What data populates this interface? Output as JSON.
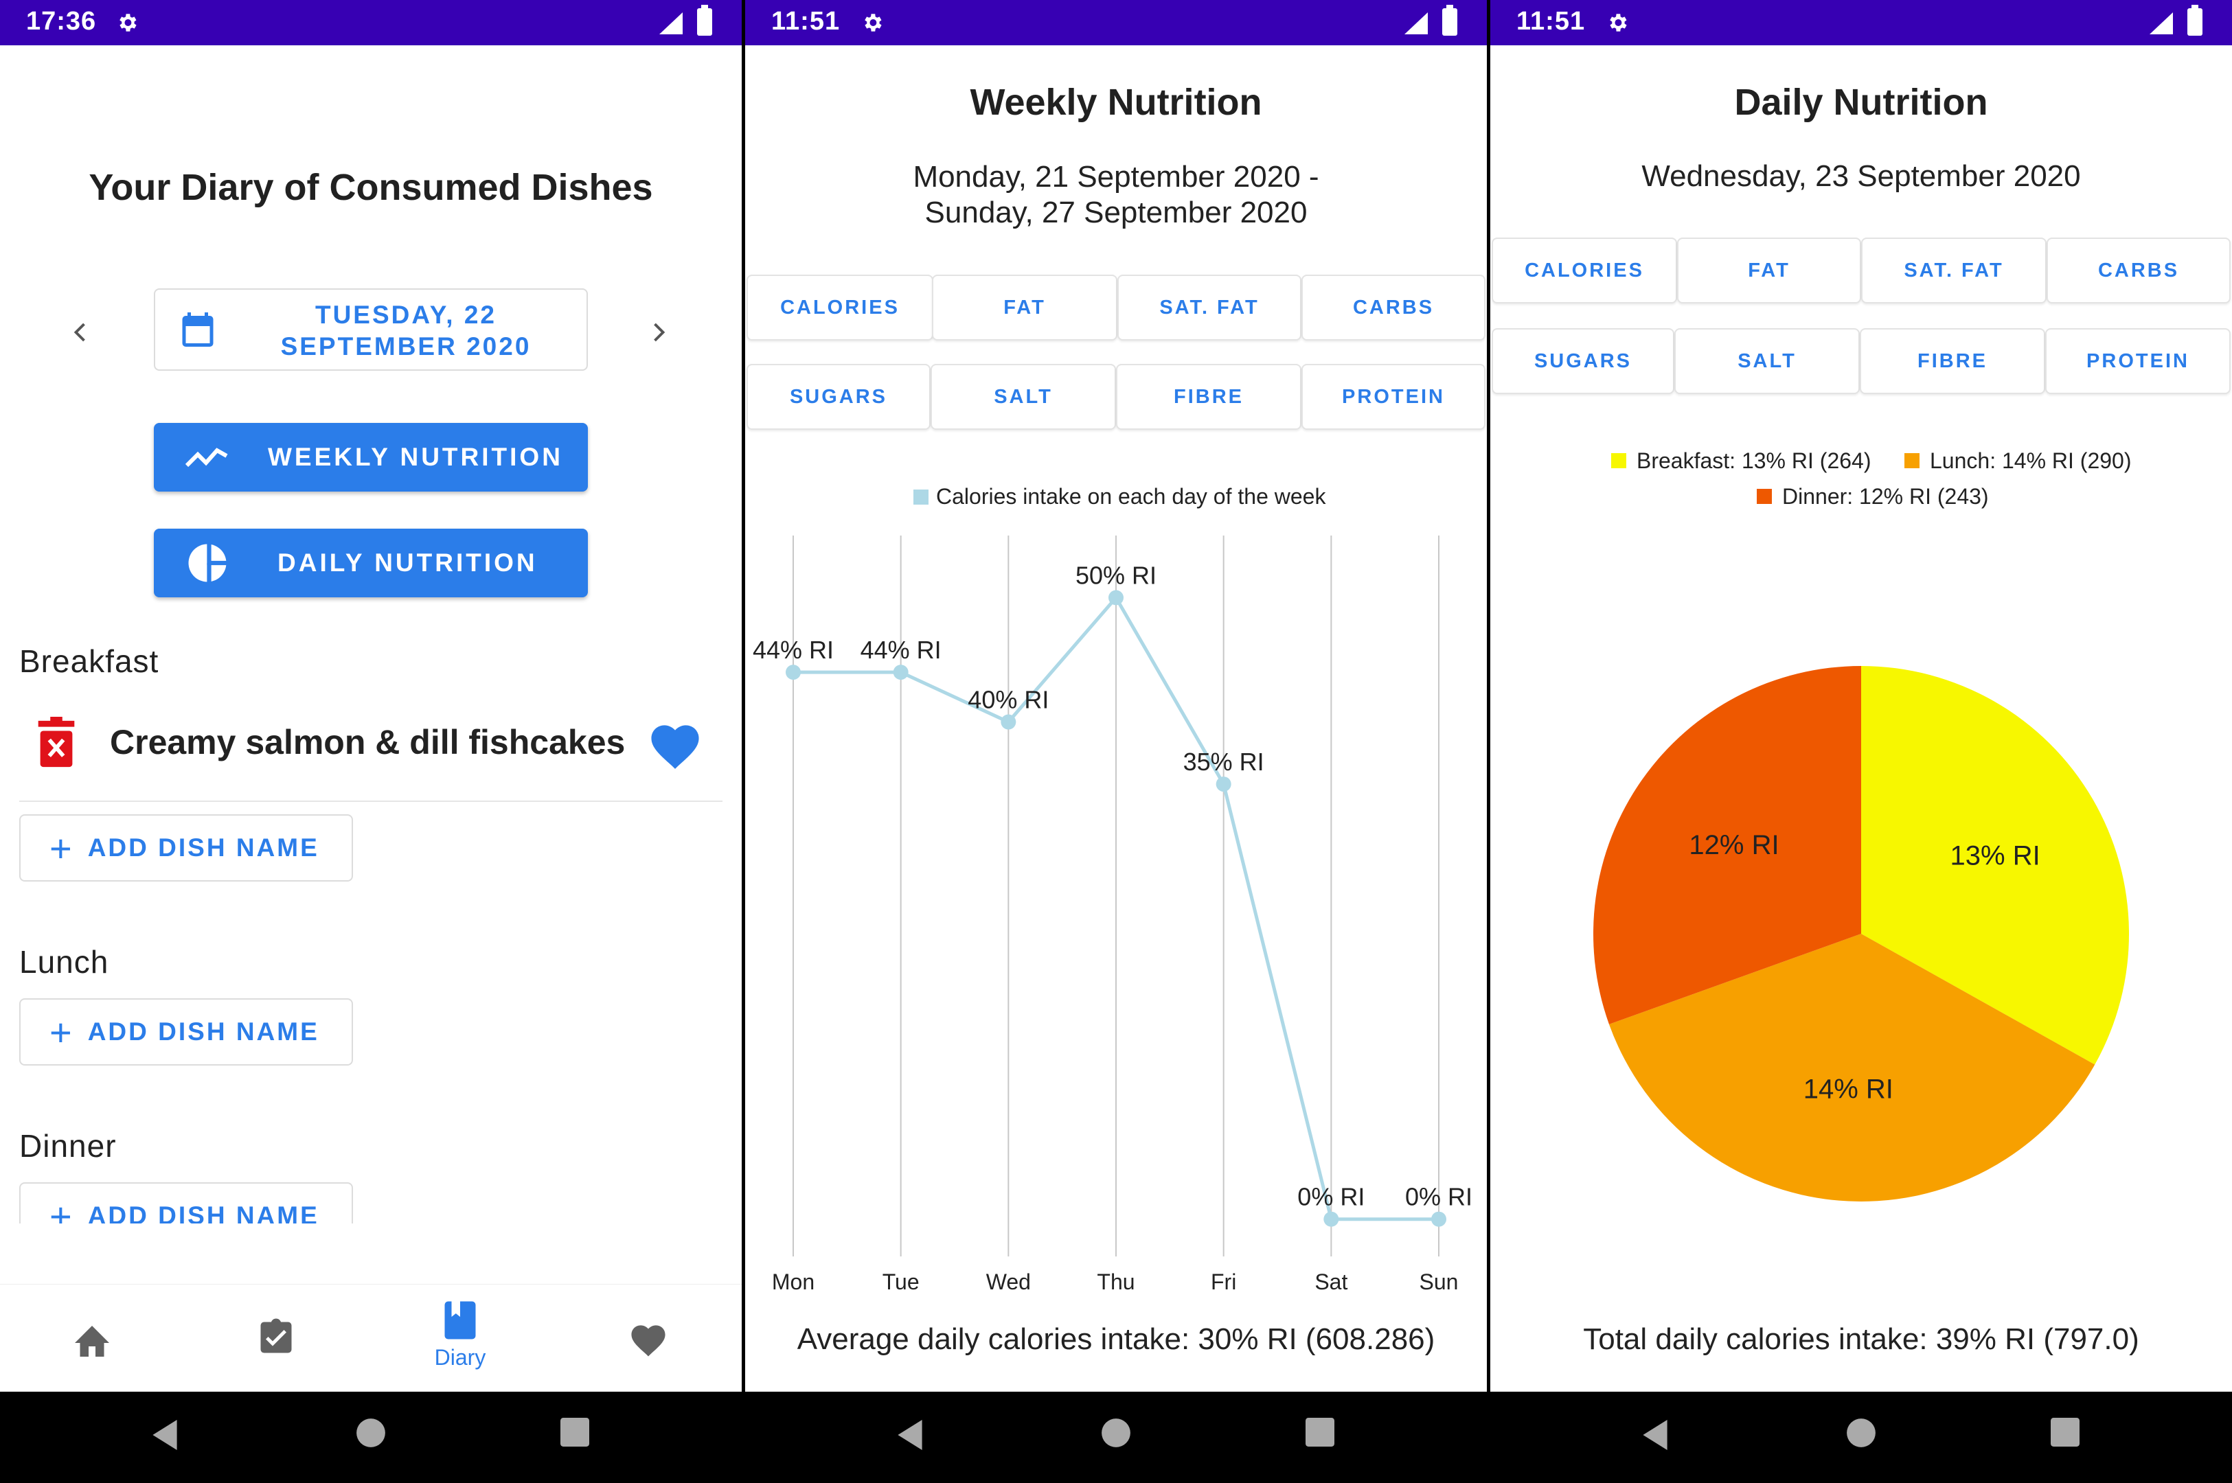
{
  "screens": {
    "diary": {
      "status_time": "17:36",
      "title": "Your Diary of Consumed Dishes",
      "date_line1": "TUESDAY, 22",
      "date_line2": "SEPTEMBER 2020",
      "weekly_button": "WEEKLY NUTRITION",
      "daily_button": "DAILY NUTRITION",
      "breakfast_label": "Breakfast",
      "breakfast_dish": "Creamy salmon & dill fishcakes",
      "lunch_label": "Lunch",
      "dinner_label": "Dinner",
      "add_dish_label": "ADD DISH NAME",
      "nav_active_label": "Diary"
    },
    "weekly": {
      "status_time": "11:51",
      "title": "Weekly Nutrition",
      "range_line1": "Monday, 21 September 2020 -",
      "range_line2": "Sunday, 27 September 2020",
      "tabs": [
        "CALORIES",
        "FAT",
        "SAT. FAT",
        "CARBS",
        "SUGARS",
        "SALT",
        "FIBRE",
        "PROTEIN"
      ],
      "footer": "Average daily calories intake: 30% RI (608.286)"
    },
    "daily": {
      "status_time": "11:51",
      "title": "Daily Nutrition",
      "date": "Wednesday, 23 September 2020",
      "tabs": [
        "CALORIES",
        "FAT",
        "SAT. FAT",
        "CARBS",
        "SUGARS",
        "SALT",
        "FIBRE",
        "PROTEIN"
      ],
      "footer": "Total daily calories intake: 39% RI (797.0)"
    }
  },
  "colors": {
    "status_bar": "#3700b3",
    "accent": "#2b7de9",
    "line": "#add8e6",
    "breakfast": "#f7f700",
    "lunch": "#f7a000",
    "dinner": "#ee5800"
  },
  "chart_data": [
    {
      "type": "line",
      "legend": "Calories intake on each day of the week",
      "categories": [
        "Mon",
        "Tue",
        "Wed",
        "Thu",
        "Fri",
        "Sat",
        "Sun"
      ],
      "values": [
        44,
        44,
        40,
        50,
        35,
        0,
        0
      ],
      "point_labels": [
        "44% RI",
        "44% RI",
        "40% RI",
        "50% RI",
        "35% RI",
        "0% RI",
        "0% RI"
      ],
      "ylim": [
        -3,
        55
      ]
    },
    {
      "type": "pie",
      "legend": [
        "Breakfast: 13% RI (264)",
        "Lunch: 14% RI (290)",
        "Dinner: 12% RI (243)"
      ],
      "slices": [
        {
          "name": "Breakfast",
          "value": 264,
          "label": "13% RI",
          "color": "#f7f700"
        },
        {
          "name": "Lunch",
          "value": 290,
          "label": "14% RI",
          "color": "#f7a000"
        },
        {
          "name": "Dinner",
          "value": 243,
          "label": "12% RI",
          "color": "#ee5800"
        }
      ]
    }
  ]
}
